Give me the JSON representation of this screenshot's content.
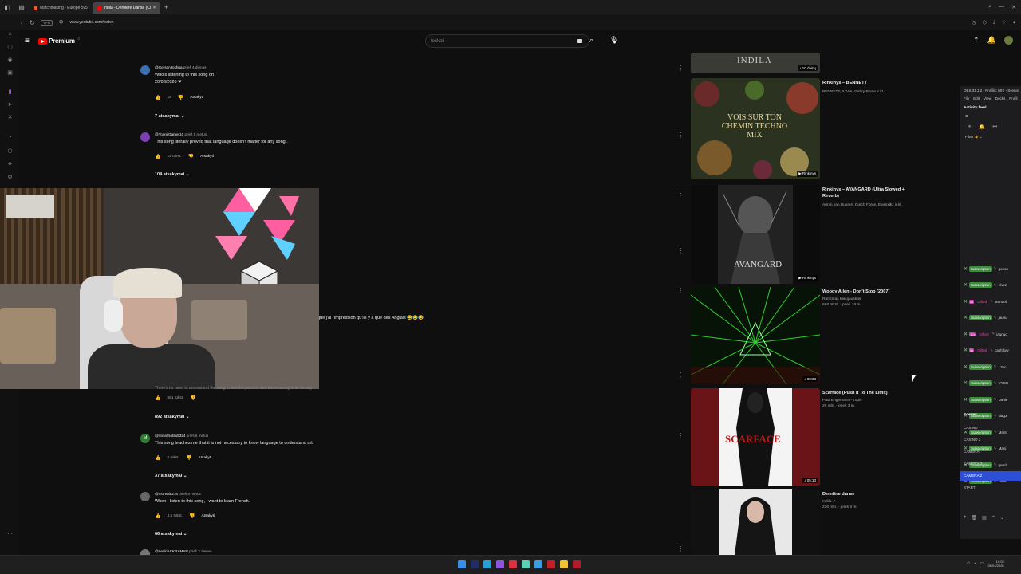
{
  "browser": {
    "tabs": [
      {
        "label": "Matchmaking - Europe 5v5",
        "active": false,
        "color": "#e0612d"
      },
      {
        "label": "Indila - Dernière Danse (Cl",
        "active": true,
        "color": "#ff0000"
      }
    ],
    "new_tab": "+",
    "url": "www.youtube.com/watch",
    "vpn_label": "VPN"
  },
  "youtube": {
    "logo_text": "Premium",
    "logo_sup": "LT",
    "search_placeholder": "Ieškoti"
  },
  "comments": [
    {
      "handle": "@GersonJoshua",
      "time": "prieš 4 dienas",
      "lines": [
        "Who's listening to this song on",
        "20/08/2026 ❤"
      ],
      "likes": "16",
      "reply_label": "Atsakyti",
      "replies": "7 atsakymai ⌄",
      "avatar_letter": "",
      "avatar_color": "#3a6fb0"
    },
    {
      "handle": "@YoonjiGamer10",
      "time": "prieš 5 metus",
      "lines": [
        "This song literally proved that language doesn't matter for any song.."
      ],
      "likes": "14 tūkst.",
      "reply_label": "Atsakyti",
      "replies": "104 atsakymai ⌄",
      "avatar_letter": "",
      "avatar_color": "#7a3fb0"
    },
    {
      "handle": "",
      "time": "",
      "lines": [],
      "likes": "551 tūkst.",
      "reply_label": "",
      "replies": "892 atsakymai ⌄",
      "avatar_letter": "",
      "avatar_color": "#555555"
    },
    {
      "handle": "@minahsotsu5324",
      "time": "prieš 5 metus",
      "lines": [
        "This song teaches me that it is not necessary to know language to understand art."
      ],
      "likes": "6 tūkst.",
      "reply_label": "Atsakyti",
      "replies": "37 atsakymai ⌄",
      "avatar_letter": "M",
      "avatar_color": "#2e7d32"
    },
    {
      "handle": "@moreal8216",
      "time": "prieš 5 metus",
      "lines": [
        "When I listen to this song, I want to learn French."
      ],
      "likes": "3,5 tūkst.",
      "reply_label": "Atsakyti",
      "replies": "66 atsakymai ⌄",
      "avatar_letter": "",
      "avatar_color": "#666666"
    },
    {
      "handle": "@LenkiACKRAMAN",
      "time": "prieš 2 dienas",
      "lines": [],
      "likes": "",
      "reply_label": "",
      "replies": "",
      "avatar_letter": "",
      "avatar_color": "#777777"
    }
  ],
  "stray_text": "que j'ai l'impression qu'ils y a que des Anglais 😂😂😂",
  "partial_text": "There's no need to understand the song to feel the passion and the meaning in its beauty",
  "recommendations": [
    {
      "title": "",
      "meta": [],
      "badge": "♪ 10 dainų",
      "thumb": "indila",
      "thumb_text": "INDILA"
    },
    {
      "title": "Rinkinys – BENNETT",
      "meta": [
        "BENNETT, ILYAA, Gabry Ponte ir kt."
      ],
      "badge": "▶ Rinkinys",
      "thumb": "vois",
      "thumb_text": "VOIS SUR TON CHEMIN TECHNO MIX"
    },
    {
      "title": "Rinkinys – AVANGARD (Ultra Slowed + Reverb)",
      "meta": [
        "Armin van Buuren, Dutch Force, Eternxlkz ir kt."
      ],
      "badge": "▶ Rinkinys",
      "thumb": "avangard",
      "thumb_text": "AVANGARD"
    },
    {
      "title": "Woody Allen - Don't Stop [2007]",
      "meta": [
        "Ramūnas Macijauskas",
        "668 tūkst. · prieš 18 m."
      ],
      "badge": "♪ 03:33",
      "thumb": "laser",
      "thumb_text": ""
    },
    {
      "title": "Scarface (Push It To The Limit)",
      "meta": [
        "Paul Engemann - Topic",
        "29 mln. · prieš 3 m."
      ],
      "badge": "♪ 05:13",
      "thumb": "scarface",
      "thumb_text": "SCARFACE"
    },
    {
      "title": "Dernière danse",
      "meta": [
        "Indila ✓",
        "236 mln. · prieš 8 m."
      ],
      "badge": "",
      "thumb": "indila2",
      "thumb_text": ""
    }
  ],
  "obs": {
    "title": "OBS 31.1.2 - Profilis: MIX - Scenos",
    "menu": [
      "File",
      "Edit",
      "View",
      "Docks",
      "Profil"
    ],
    "dock_title": "Activity feed",
    "filter_label": "Filter",
    "feed": [
      {
        "type": "Subscription",
        "name": "gonso"
      },
      {
        "type": "Subscription",
        "name": "elvez"
      },
      {
        "type": "Gifted",
        "level": "5x",
        "name": "jaunuoli"
      },
      {
        "type": "Subscription",
        "name": "jaunu"
      },
      {
        "type": "Gifted",
        "level": "10x",
        "name": "jaunuo"
      },
      {
        "type": "Gifted",
        "level": "5x",
        "name": "cashflow"
      },
      {
        "type": "Subscription",
        "name": "L3nc"
      },
      {
        "type": "Subscription",
        "name": "VYCH"
      },
      {
        "type": "Subscription",
        "name": "Danie"
      },
      {
        "type": "Subscription",
        "name": "slag3"
      },
      {
        "type": "Subscription",
        "name": "Mant"
      },
      {
        "type": "Subscription",
        "name": "Manj"
      },
      {
        "type": "Subscription",
        "name": "gendr"
      },
      {
        "type": "Subscription",
        "name": "Tomu"
      }
    ],
    "scenes_title": "Scenes",
    "scenes": [
      {
        "name": "CASINO",
        "selected": false
      },
      {
        "name": "CASINO 2",
        "selected": false
      },
      {
        "name": "CAMERA",
        "selected": false
      },
      {
        "name": "CAMERA 3",
        "selected": false
      },
      {
        "name": "CAMERA 2",
        "selected": true
      },
      {
        "name": "START",
        "selected": false
      }
    ]
  },
  "taskbar": {
    "time": "19:03",
    "date": "08/04/2026"
  },
  "colors": {
    "youtube_red": "#ff0000",
    "subscription_green": "#3c8c3c",
    "gift_pink": "#d946a8",
    "obs_selected": "#2d4fd8"
  }
}
